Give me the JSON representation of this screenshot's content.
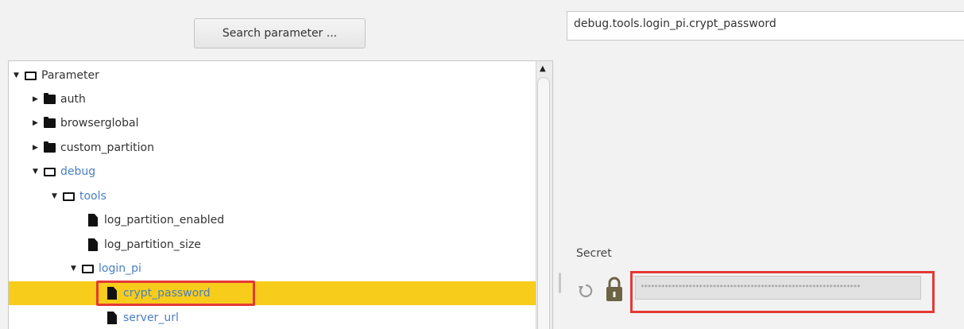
{
  "toolbar": {
    "search_label": "Search parameter ..."
  },
  "tree": {
    "root_label": "Parameter",
    "items": [
      {
        "label": "auth",
        "expanded": false,
        "type": "folder"
      },
      {
        "label": "browserglobal",
        "expanded": false,
        "type": "folder"
      },
      {
        "label": "custom_partition",
        "expanded": false,
        "type": "folder"
      },
      {
        "label": "debug",
        "expanded": true,
        "type": "folder"
      },
      {
        "label": "tools",
        "expanded": true,
        "type": "folder"
      },
      {
        "label": "log_partition_enabled",
        "type": "file"
      },
      {
        "label": "log_partition_size",
        "type": "file"
      },
      {
        "label": "login_pi",
        "expanded": true,
        "type": "folder"
      },
      {
        "label": "crypt_password",
        "type": "file",
        "selected": true
      },
      {
        "label": "server_url",
        "type": "file"
      }
    ]
  },
  "detail": {
    "path": "debug.tools.login_pi.crypt_password",
    "field_label": "Secret",
    "masked_value": "****************************************************************"
  },
  "colors": {
    "selection": "#f8cc1b",
    "link_blue": "#4a7fc1",
    "highlight_red": "#e53935"
  }
}
